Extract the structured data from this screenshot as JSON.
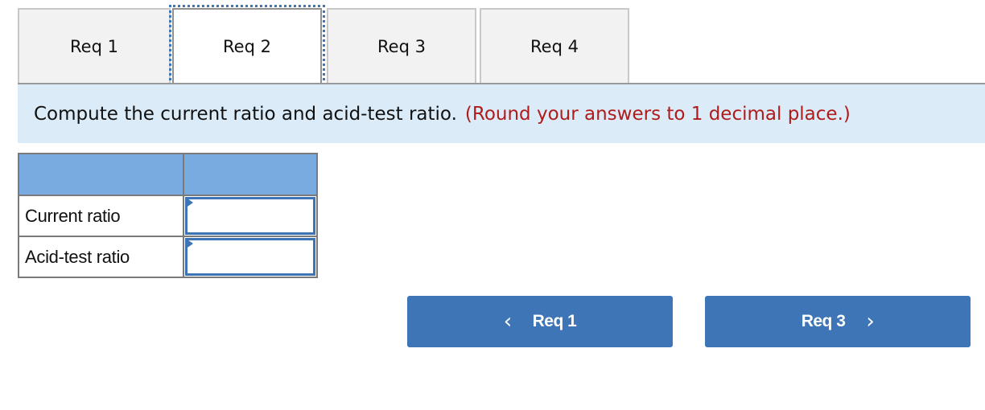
{
  "tabs": [
    {
      "label": "Req 1",
      "active": false
    },
    {
      "label": "Req 2",
      "active": true
    },
    {
      "label": "Req 3",
      "active": false
    },
    {
      "label": "Req 4",
      "active": false
    }
  ],
  "instruction": {
    "text": "Compute the current ratio and acid-test ratio.",
    "note": "(Round your answers to 1 decimal place.)"
  },
  "table": {
    "headers": [
      "",
      ""
    ],
    "rows": [
      {
        "label": "Current ratio",
        "value": ""
      },
      {
        "label": "Acid-test ratio",
        "value": ""
      }
    ]
  },
  "nav": {
    "prev_label": "Req 1",
    "next_label": "Req 3",
    "prev_icon": "chevron-left-icon",
    "next_icon": "chevron-right-icon"
  },
  "colors": {
    "accent": "#3d75b6",
    "header_fill": "#7aabe0",
    "instruction_bg": "#dbebf7",
    "note_red": "#b01b1b"
  }
}
